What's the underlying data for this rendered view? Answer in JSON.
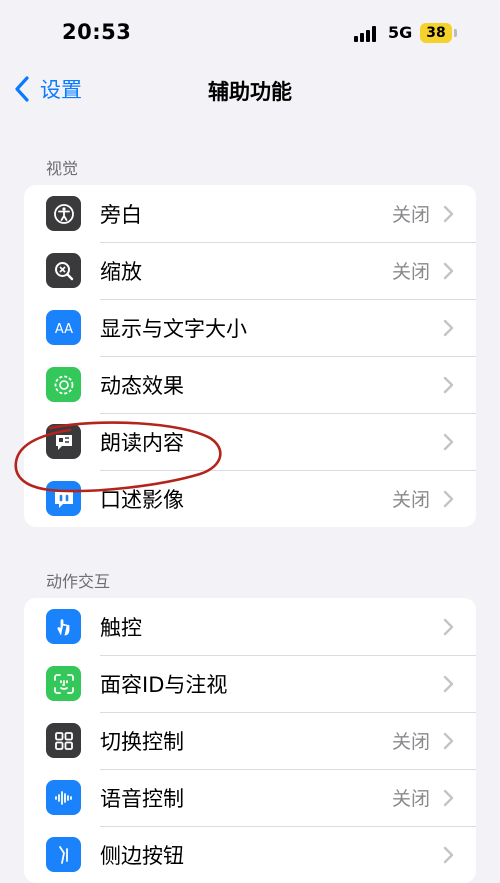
{
  "status": {
    "time": "20:53",
    "network": "5G",
    "battery": "38"
  },
  "nav": {
    "back_label": "设置",
    "title": "辅助功能"
  },
  "sections": [
    {
      "header": "视觉",
      "rows": [
        {
          "label": "旁白",
          "value": "关闭",
          "icon": "voiceover-icon",
          "color": "#3a3a3c"
        },
        {
          "label": "缩放",
          "value": "关闭",
          "icon": "zoom-icon",
          "color": "#3a3a3c"
        },
        {
          "label": "显示与文字大小",
          "value": "",
          "icon": "text-size-icon",
          "color": "#1a82fb"
        },
        {
          "label": "动态效果",
          "value": "",
          "icon": "motion-icon",
          "color": "#34c759"
        },
        {
          "label": "朗读内容",
          "value": "",
          "icon": "spoken-content-icon",
          "color": "#3a3a3c"
        },
        {
          "label": "口述影像",
          "value": "关闭",
          "icon": "audio-description-icon",
          "color": "#1a82fb"
        }
      ]
    },
    {
      "header": "动作交互",
      "rows": [
        {
          "label": "触控",
          "value": "",
          "icon": "touch-icon",
          "color": "#1a82fb"
        },
        {
          "label": "面容ID与注视",
          "value": "",
          "icon": "face-id-icon",
          "color": "#34c759"
        },
        {
          "label": "切换控制",
          "value": "关闭",
          "icon": "switch-control-icon",
          "color": "#3a3a3c"
        },
        {
          "label": "语音控制",
          "value": "关闭",
          "icon": "voice-control-icon",
          "color": "#1a82fb"
        },
        {
          "label": "侧边按钮",
          "value": "",
          "icon": "side-button-icon",
          "color": "#1a82fb"
        }
      ]
    }
  ],
  "colors": {
    "accent": "#0a7aff",
    "annotation": "#b3241c"
  }
}
